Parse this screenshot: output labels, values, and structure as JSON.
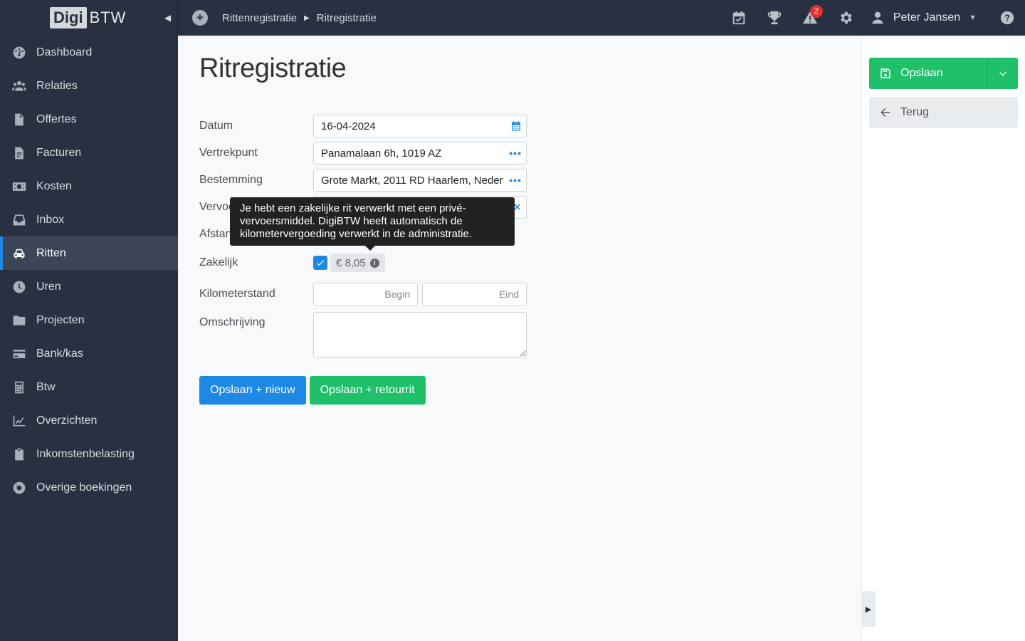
{
  "brand": {
    "logo_a": "Digi",
    "logo_b": "BTW"
  },
  "breadcrumb": [
    "Rittenregistratie",
    "Ritregistratie"
  ],
  "header": {
    "alerts_count": "2",
    "user_name": "Peter Jansen",
    "help": "?"
  },
  "sidebar": {
    "items": [
      {
        "label": "Dashboard",
        "icon": "dashboard-icon"
      },
      {
        "label": "Relaties",
        "icon": "users-icon"
      },
      {
        "label": "Offertes",
        "icon": "file-icon"
      },
      {
        "label": "Facturen",
        "icon": "invoice-icon"
      },
      {
        "label": "Kosten",
        "icon": "money-icon"
      },
      {
        "label": "Inbox",
        "icon": "inbox-icon"
      },
      {
        "label": "Ritten",
        "icon": "car-icon",
        "active": true
      },
      {
        "label": "Uren",
        "icon": "clock-icon"
      },
      {
        "label": "Projecten",
        "icon": "folder-icon"
      },
      {
        "label": "Bank/kas",
        "icon": "card-icon"
      },
      {
        "label": "Btw",
        "icon": "calculator-icon"
      },
      {
        "label": "Overzichten",
        "icon": "chart-icon"
      },
      {
        "label": "Inkomstenbelasting",
        "icon": "clipboard-icon"
      },
      {
        "label": "Overige boekingen",
        "icon": "lifering-icon"
      }
    ]
  },
  "page": {
    "title": "Ritregistratie"
  },
  "form": {
    "datum_label": "Datum",
    "datum_value": "16-04-2024",
    "vertrekpunt_label": "Vertrekpunt",
    "vertrekpunt_value": "Panamalaan 6h, 1019 AZ",
    "bestemming_label": "Bestemming",
    "bestemming_value": "Grote Markt, 2011 RD Haarlem, Neder",
    "vervoer_label": "Vervoer",
    "afstand_label": "Afstand",
    "zakelijk_label": "Zakelijk",
    "zakelijk_amount": "€ 8,05",
    "kilometerstand_label": "Kilometerstand",
    "km_begin_placeholder": "Begin",
    "km_eind_placeholder": "Eind",
    "omschrijving_label": "Omschrijving"
  },
  "tooltip": {
    "text": "Je hebt een zakelijke rit verwerkt met een privé-vervoersmiddel. DigiBTW heeft automatisch de kilometervergoeding verwerkt in de administratie."
  },
  "buttons": {
    "save_new": "Opslaan + nieuw",
    "save_return": "Opslaan + retourrit"
  },
  "rightpanel": {
    "save_label": "Opslaan",
    "back_label": "Terug"
  },
  "colors": {
    "sidebar_bg": "#283142",
    "primary": "#1e88e5",
    "success": "#1ec06a"
  }
}
